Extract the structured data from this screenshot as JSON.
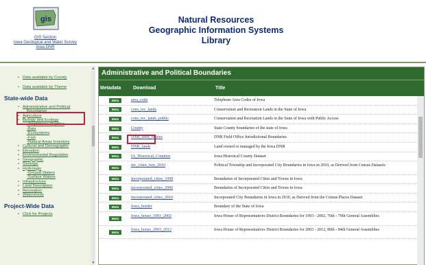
{
  "header": {
    "logo_text": "gis",
    "logo_caption_1": "GIS Section",
    "logo_caption_2": "Iowa Geological and Water Survey",
    "logo_caption_3": "Iowa DNR",
    "title_1": "Natural Resources",
    "title_2": "Geographic Information Systems",
    "title_3": "Library"
  },
  "sidebar": {
    "top_links": [
      "Data available by County",
      "Data available by Theme"
    ],
    "state_heading": "State-wide Data",
    "items": [
      {
        "label": "Administrative and Political",
        "sub": false
      },
      {
        "label": "Boundaries",
        "sub": true,
        "cont": true
      },
      {
        "label": "Agriculture",
        "sub": false
      },
      {
        "label": "Biology and Ecology",
        "sub": false
      },
      {
        "label": "-Amphibians-Reptiles",
        "sub": true
      },
      {
        "label": "-Bats",
        "sub": true
      },
      {
        "label": "-Ecosystems",
        "sub": true
      },
      {
        "label": "-Fish",
        "sub": true
      },
      {
        "label": "-Natural Areas Inventory",
        "sub": true
      },
      {
        "label": "Cultural and Demographic",
        "sub": false
      },
      {
        "label": "Elevation",
        "sub": false
      },
      {
        "label": "Environmental Regulation",
        "sub": false
      },
      {
        "label": "Geographic",
        "sub": false
      },
      {
        "label": "Geologic",
        "sub": false
      },
      {
        "label": "Hydrologic",
        "sub": false
      },
      {
        "label": "-Ground Waters",
        "sub": true
      },
      {
        "label": "-Surface Waters",
        "sub": true
      },
      {
        "label": "Infrastructure",
        "sub": false
      },
      {
        "label": "Land Description",
        "sub": false
      },
      {
        "label": "Recreation",
        "sub": false
      },
      {
        "label": "Watersheds",
        "sub": false
      }
    ],
    "project_heading": "Project-Wide Data",
    "project_link": "Click for Projects"
  },
  "main": {
    "panel_title": "Administrative and Political Boundaries",
    "col_metadata": "Metadata",
    "col_download": "Download",
    "col_title": "Title",
    "meta_label": "Meta",
    "rows": [
      {
        "download": "area_code",
        "title": "Telephone Area Codes of Iowa",
        "tall": false
      },
      {
        "download": "cons_rec_lands",
        "title": "Conservation and Recreation Lands in the State of Iowa",
        "tall": false
      },
      {
        "download": "cons_rec_lands_public",
        "title": "Conservation and Recreation Lands in the State of Iowa with Public Access",
        "tall": false
      },
      {
        "download": "County",
        "title": "State County boundaries of the state of Iowa",
        "tall": false
      },
      {
        "download": "DNR_field_offices",
        "title": "DNR Field Office Jurisdictional Boundaries",
        "tall": false
      },
      {
        "download": "DNR_lands",
        "title": "Land owned or managed by the Iowa DNR",
        "tall": false
      },
      {
        "download": "IA_Historical_Counties",
        "title": "Iowa Historical County Dataset",
        "tall": false
      },
      {
        "download": "inc_cities_twp_2010",
        "title": "Political Township and Incorporated City Boundaries in Iowa in 2010, as Derived from Census Datasets",
        "tall": true
      },
      {
        "download": "Incorporated_cities_1990",
        "title": "Boundaries of Incorporated Cities and Towns in Iowa",
        "tall": false
      },
      {
        "download": "incorporated_cities_2000",
        "title": "Boundaries of Incorporated Cities and Towns in Iowa",
        "tall": false
      },
      {
        "download": "incorporated_cities_2010",
        "title": "Incorporated City Boundaries in Iowa in 2010, as Derived from the Census Places Dataset",
        "tall": false
      },
      {
        "download": "Iowa_border",
        "title": "Boundary of the State of Iowa",
        "tall": false
      },
      {
        "download": "Iowa_house_1993_2002",
        "title": "Iowa House of Representatives District Boundaries for 1993 - 2002, 76th - 79th General Assemblies",
        "tall": true
      },
      {
        "download": "Iowa_house_2003_2012",
        "title": "Iowa House of Representatives District Boundaries for 2003 - 2012, 80th - 84th General Assemblies",
        "tall": true
      }
    ]
  },
  "colors": {
    "accent_green": "#2f6b2f",
    "highlight_red": "#c0203a",
    "title_blue": "#0b2a7a"
  }
}
